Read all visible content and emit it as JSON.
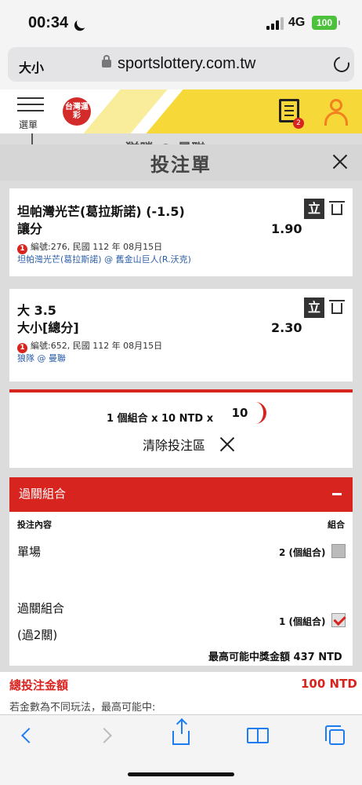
{
  "status": {
    "time": "00:34",
    "network": "4G",
    "battery": "100"
  },
  "browser": {
    "text_size_label": "大小",
    "url": "sportslottery.com.tw"
  },
  "site": {
    "menu_label": "選單",
    "logo_text": "台灣運彩",
    "bet_count": "2"
  },
  "behind_title": "猶勝 @ 曼聯",
  "sheet": {
    "title": "投注單"
  },
  "bets": [
    {
      "selection": "坦帕灣光芒(葛拉斯諾) (-1.5)",
      "market": "讓分",
      "odds": "1.90",
      "info_num": "1",
      "info": "編號:276, 民國 112 年 08月15日",
      "teams": "坦帕灣光芒(葛拉斯諾) @ 舊金山巨人(R.沃克)",
      "stand_label": "立"
    },
    {
      "selection": "大 3.5",
      "market": "大小[總分]",
      "odds": "2.30",
      "info_num": "1",
      "info": "編號:652, 民國 112 年 08月15日",
      "teams": "狼隊 @ 曼聯",
      "stand_label": "立"
    }
  ],
  "stake": {
    "combo_text": "1 個組合 x 10 NTD x",
    "amount": "10",
    "clear_label": "清除投注區"
  },
  "parlay": {
    "header": "過關組合",
    "col_content": "投注內容",
    "col_combo": "組合",
    "single_label": "單場",
    "single_count": "2 (個組合)",
    "single_checked": false,
    "parlay_label": "過關組合",
    "parlay_sub": "(過2關)",
    "parlay_count": "1 (個組合)",
    "parlay_checked": true,
    "max_win": "最高可能中獎金額 437 NTD"
  },
  "total": {
    "label": "總投注金額",
    "value": "100 NTD",
    "note": "若金數為不同玩法，最高可能中:"
  },
  "colors": {
    "accent": "#d8241f",
    "brand_yellow": "#f6d838",
    "ios_blue": "#1e7cf2"
  }
}
